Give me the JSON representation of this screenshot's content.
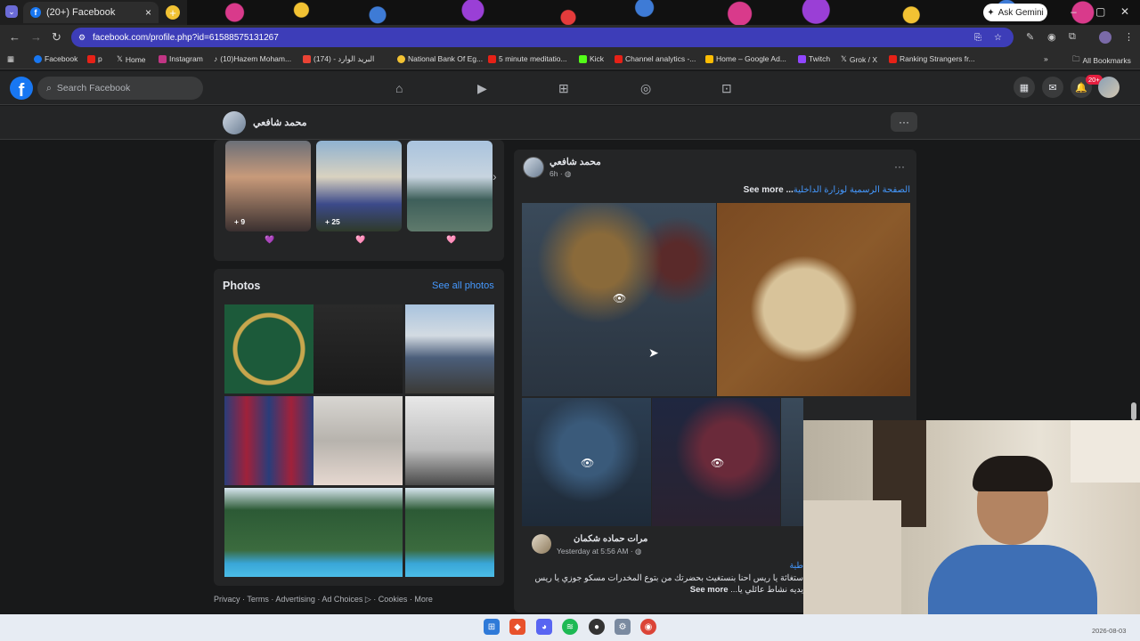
{
  "browser": {
    "tab_title": "(20+) Facebook",
    "tab_close": "×",
    "new_tab": "+",
    "gemini_label": "Ask Gemini",
    "url": "facebook.com/profile.php?id=61588575131267",
    "bookmarks": [
      "Facebook",
      "p",
      "Home",
      "Instagram",
      "(10)Hazem Moham...",
      "(174) - البريد الوارد",
      "National Bank Of Eg...",
      "5 minute meditatio...",
      "Kick",
      "Channel analytics -...",
      "Home – Google Ad...",
      "Twitch",
      "Grok / X",
      "Ranking Strangers fr..."
    ],
    "all_bookmarks": "All Bookmarks",
    "bookmarks_overflow": "»"
  },
  "facebook": {
    "logo": "f",
    "search_placeholder": "Search Facebook",
    "notifications_badge": "20+"
  },
  "profile": {
    "name": "محمد شافعي",
    "more_button": "···"
  },
  "featured": [
    {
      "count": "+ 9",
      "tag": "💜"
    },
    {
      "count": "+ 25",
      "tag": "🩷"
    },
    {
      "count": "",
      "tag": "🩷"
    }
  ],
  "photos": {
    "title": "Photos",
    "see_all": "See all photos"
  },
  "footer": "Privacy · Terms · Advertising · Ad Choices ▷ · Cookies · More",
  "post": {
    "author": "محمد شافعي",
    "time": "6h · ◍",
    "link_text": "الصفحة الرسمية لوزارة الداخلية",
    "see_more": "See more ...",
    "menu": "···"
  },
  "shared_post": {
    "author": "مرات حماده شكمان",
    "time": "Yesterday at 5:56 AM · ◍",
    "link_fragment": "طية",
    "line1": "ستغاثة يا ريس احنا بنستغيث بحضرتك من بتوع المخدرات مسكو جوزي يا ريس",
    "line2_more": "See more",
    "line2": "...يديه نشاط عائلي يا"
  },
  "taskbar": {
    "date": "2026-08-03"
  }
}
